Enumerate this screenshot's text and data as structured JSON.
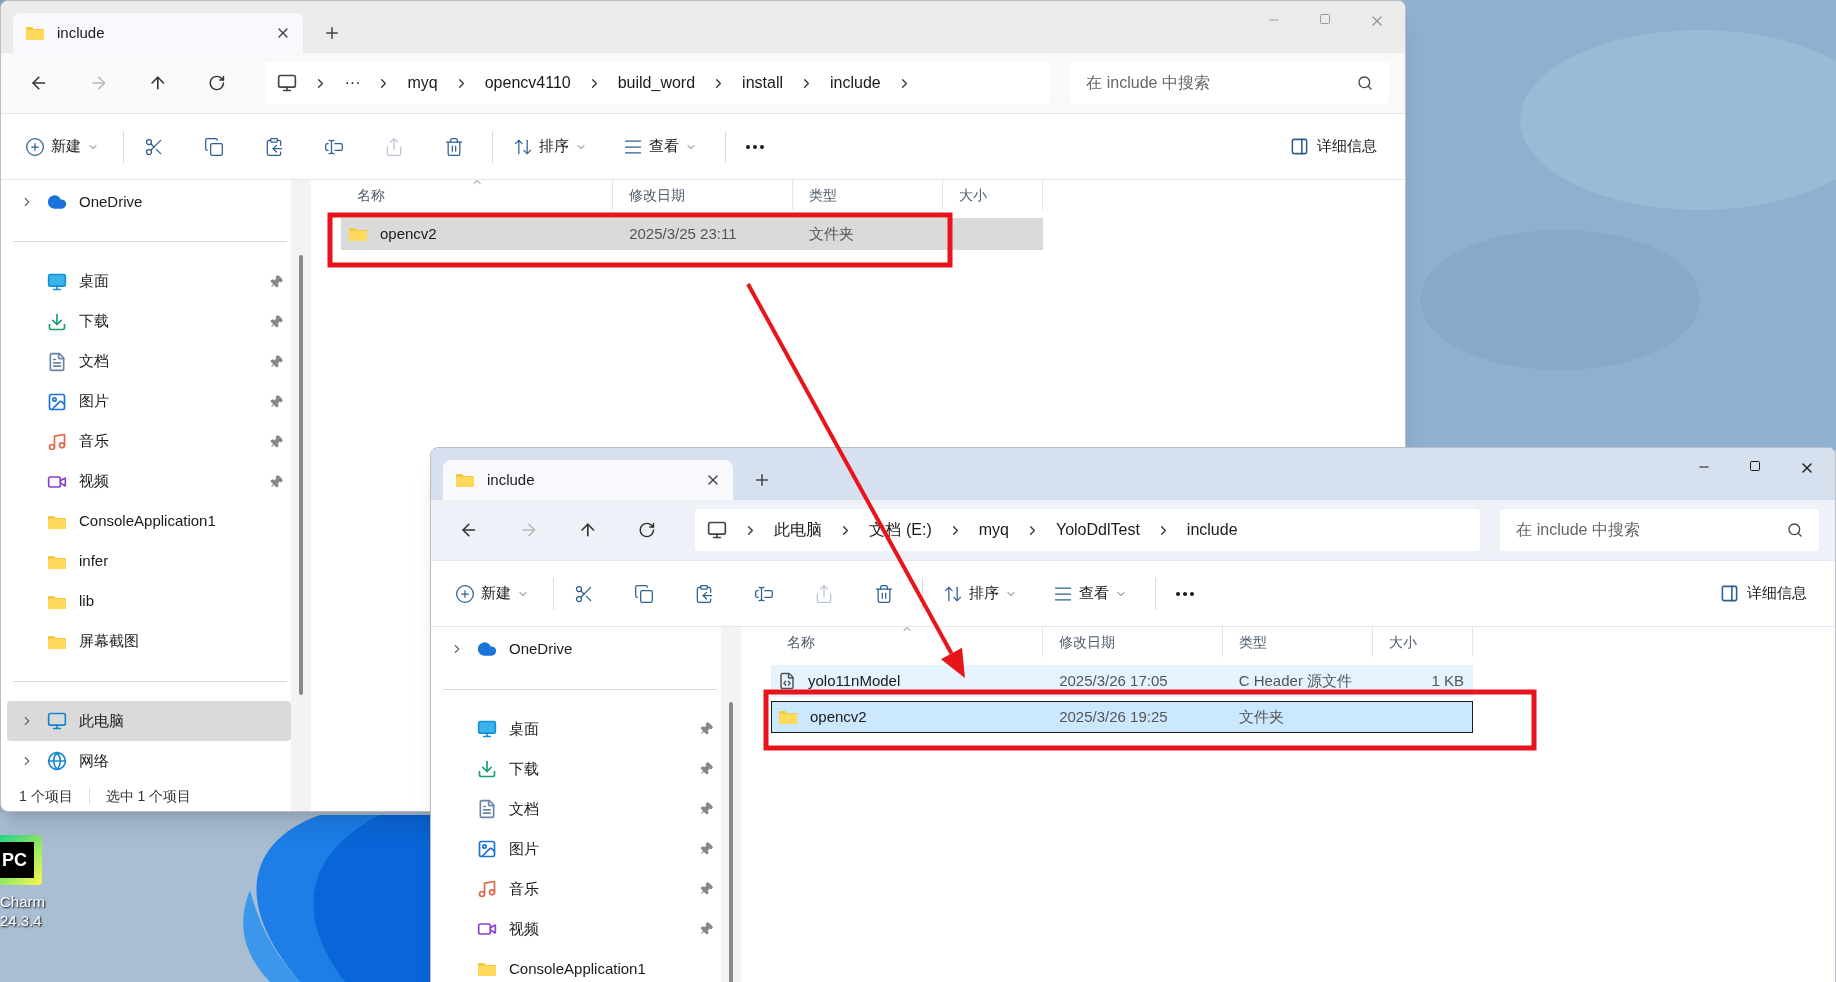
{
  "windows": [
    {
      "active": false,
      "tab": {
        "title": "include"
      },
      "breadcrumb": {
        "items": [
          "···",
          "myq",
          "opencv4110",
          "build_word",
          "install",
          "include"
        ],
        "trailing_chevron": true
      },
      "search": {
        "placeholder": "在 include 中搜索"
      },
      "toolbar": [
        {
          "kind": "new",
          "label": "新建",
          "disabled": false
        },
        {
          "kind": "cut",
          "disabled": false
        },
        {
          "kind": "copy",
          "disabled": false
        },
        {
          "kind": "paste",
          "disabled": false
        },
        {
          "kind": "rename",
          "disabled": false
        },
        {
          "kind": "share",
          "disabled": true
        },
        {
          "kind": "delete",
          "disabled": false
        },
        {
          "kind": "sort",
          "label": "排序",
          "disabled": false
        },
        {
          "kind": "view",
          "label": "查看",
          "disabled": false
        },
        {
          "kind": "more",
          "disabled": false
        }
      ],
      "details_button": "详细信息",
      "sidebar": {
        "groups": [
          [
            {
              "kind": "onedrive",
              "label": "OneDrive",
              "expandable": true,
              "pinned": false,
              "selected": false
            }
          ],
          [
            {
              "kind": "desktop",
              "label": "桌面",
              "expandable": false,
              "pinned": true,
              "selected": false
            },
            {
              "kind": "downloads",
              "label": "下载",
              "expandable": false,
              "pinned": true,
              "selected": false
            },
            {
              "kind": "documents",
              "label": "文档",
              "expandable": false,
              "pinned": true,
              "selected": false
            },
            {
              "kind": "pictures",
              "label": "图片",
              "expandable": false,
              "pinned": true,
              "selected": false
            },
            {
              "kind": "music",
              "label": "音乐",
              "expandable": false,
              "pinned": true,
              "selected": false
            },
            {
              "kind": "videos",
              "label": "视频",
              "expandable": false,
              "pinned": true,
              "selected": false
            },
            {
              "kind": "folder",
              "label": "ConsoleApplication1",
              "expandable": false,
              "pinned": false,
              "selected": false
            },
            {
              "kind": "folder",
              "label": "infer",
              "expandable": false,
              "pinned": false,
              "selected": false
            },
            {
              "kind": "folder",
              "label": "lib",
              "expandable": false,
              "pinned": false,
              "selected": false
            },
            {
              "kind": "folder",
              "label": "屏幕截图",
              "expandable": false,
              "pinned": false,
              "selected": false
            }
          ],
          [
            {
              "kind": "pc",
              "label": "此电脑",
              "expandable": true,
              "pinned": false,
              "selected": true
            },
            {
              "kind": "network",
              "label": "网络",
              "expandable": true,
              "pinned": false,
              "selected": false
            }
          ]
        ]
      },
      "columns": [
        {
          "label": "名称",
          "sorted": true
        },
        {
          "label": "修改日期",
          "sorted": false
        },
        {
          "label": "类型",
          "sorted": false
        },
        {
          "label": "大小",
          "sorted": false
        }
      ],
      "rows": [
        {
          "kind": "folder",
          "name": "opencv2",
          "modified": "2025/3/25 23:11",
          "type": "文件夹",
          "selected": true,
          "hovered": false
        }
      ],
      "status_bar": [
        "1 个项目",
        "选中 1 个项目"
      ]
    },
    {
      "active": true,
      "tab": {
        "title": "include"
      },
      "breadcrumb": {
        "items": [
          "此电脑",
          "文档 (E:)",
          "myq",
          "YoloDdlTest",
          "include"
        ],
        "trailing_chevron": false
      },
      "search": {
        "placeholder": "在 include 中搜索"
      },
      "toolbar": [
        {
          "kind": "new",
          "label": "新建",
          "disabled": false
        },
        {
          "kind": "cut",
          "disabled": false
        },
        {
          "kind": "copy",
          "disabled": false
        },
        {
          "kind": "paste",
          "disabled": false
        },
        {
          "kind": "rename",
          "disabled": false
        },
        {
          "kind": "share",
          "disabled": true
        },
        {
          "kind": "delete",
          "disabled": false
        },
        {
          "kind": "sort",
          "label": "排序",
          "disabled": false
        },
        {
          "kind": "view",
          "label": "查看",
          "disabled": false
        },
        {
          "kind": "more",
          "disabled": false
        }
      ],
      "details_button": "详细信息",
      "sidebar": {
        "groups": [
          [
            {
              "kind": "onedrive",
              "label": "OneDrive",
              "expandable": true,
              "pinned": false,
              "selected": false
            }
          ],
          [
            {
              "kind": "desktop",
              "label": "桌面",
              "expandable": false,
              "pinned": true,
              "selected": false
            },
            {
              "kind": "downloads",
              "label": "下载",
              "expandable": false,
              "pinned": true,
              "selected": false
            },
            {
              "kind": "documents",
              "label": "文档",
              "expandable": false,
              "pinned": true,
              "selected": false
            },
            {
              "kind": "pictures",
              "label": "图片",
              "expandable": false,
              "pinned": true,
              "selected": false
            },
            {
              "kind": "music",
              "label": "音乐",
              "expandable": false,
              "pinned": true,
              "selected": false
            },
            {
              "kind": "videos",
              "label": "视频",
              "expandable": false,
              "pinned": true,
              "selected": false
            },
            {
              "kind": "folder",
              "label": "ConsoleApplication1",
              "expandable": false,
              "pinned": false,
              "selected": false
            }
          ]
        ]
      },
      "columns": [
        {
          "label": "名称",
          "sorted": true
        },
        {
          "label": "修改日期",
          "sorted": false
        },
        {
          "label": "类型",
          "sorted": false
        },
        {
          "label": "大小",
          "sorted": false
        }
      ],
      "rows": [
        {
          "kind": "file",
          "name": "yolo11nModel",
          "modified": "2025/3/26 17:05",
          "type": "C Header 源文件",
          "size": "1 KB",
          "selected": false,
          "hovered": true
        },
        {
          "kind": "folder",
          "name": "opencv2",
          "modified": "2025/3/26 19:25",
          "type": "文件夹",
          "selected": true,
          "hovered": false
        }
      ]
    }
  ],
  "desktop_icons": [
    {
      "logo": "PC",
      "label_lines": [
        "Charm",
        "24.3.4"
      ]
    }
  ],
  "annotations": [
    {
      "kind": "frame"
    },
    {
      "kind": "arrow"
    },
    {
      "kind": "frame"
    }
  ]
}
